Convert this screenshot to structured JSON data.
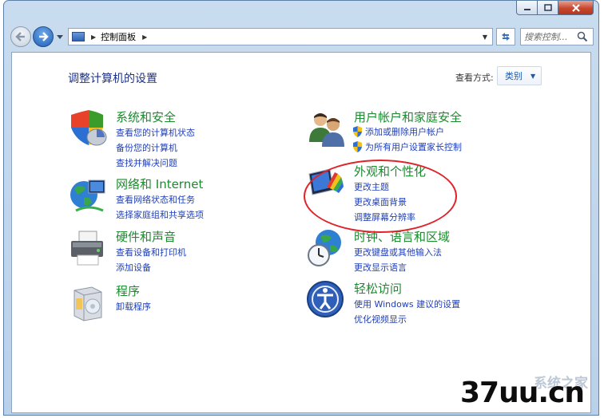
{
  "window": {
    "caption_buttons": [
      {
        "name": "minimize",
        "icon": "minimize-icon"
      },
      {
        "name": "maximize",
        "icon": "maximize-icon"
      },
      {
        "name": "close",
        "icon": "close-icon"
      }
    ]
  },
  "address_bar": {
    "breadcrumb": "控制面板",
    "search_placeholder": "搜索控制..."
  },
  "header": {
    "title": "调整计算机的设置",
    "view_label": "查看方式:",
    "view_value": "类别"
  },
  "categories": [
    {
      "title": "系统和安全",
      "icon": "shield-icon",
      "links": [
        "查看您的计算机状态",
        "备份您的计算机",
        "查找并解决问题"
      ]
    },
    {
      "title": "网络和 Internet",
      "icon": "network-globe-icon",
      "links": [
        "查看网络状态和任务",
        "选择家庭组和共享选项"
      ]
    },
    {
      "title": "硬件和声音",
      "icon": "printer-icon",
      "links": [
        "查看设备和打印机",
        "添加设备"
      ]
    },
    {
      "title": "程序",
      "icon": "programs-box-icon",
      "links": [
        "卸载程序"
      ]
    },
    {
      "title": "用户帐户和家庭安全",
      "icon": "users-icon",
      "links": [
        "添加或删除用户帐户",
        "为所有用户设置家长控制"
      ]
    },
    {
      "title": "外观和个性化",
      "icon": "appearance-monitor-icon",
      "links": [
        "更改主题",
        "更改桌面背景",
        "调整屏幕分辨率"
      ]
    },
    {
      "title": "时钟、语言和区域",
      "icon": "clock-globe-icon",
      "links": [
        "更改键盘或其他输入法",
        "更改显示语言"
      ]
    },
    {
      "title": "轻松访问",
      "icon": "ease-of-access-icon",
      "links": [
        "使用 Windows 建议的设置",
        "优化视频显示"
      ]
    }
  ],
  "watermark": {
    "text": "37uu.cn",
    "faint": "系统之家"
  },
  "colors": {
    "title_green": "#1c8a2e",
    "link_blue": "#1f3fb8",
    "highlight_red": "#e0232a"
  }
}
